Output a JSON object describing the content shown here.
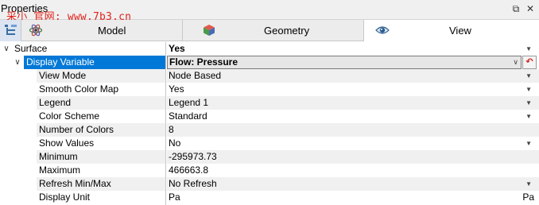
{
  "window": {
    "title": "Properties",
    "watermark": "采小 官网: www.7b3.cn"
  },
  "tabs": [
    {
      "label": "Model",
      "icon": "model-atom-icon"
    },
    {
      "label": "Geometry",
      "icon": "geometry-cube-icon"
    },
    {
      "label": "View",
      "icon": "eye-icon"
    }
  ],
  "grid": {
    "surface": {
      "label": "Surface",
      "value": "Yes"
    },
    "display_variable": {
      "label": "Display Variable",
      "value": "Flow: Pressure"
    },
    "rows": [
      {
        "label": "View Mode",
        "value": "Node Based",
        "dropdown": true
      },
      {
        "label": "Smooth Color Map",
        "value": "Yes",
        "dropdown": true
      },
      {
        "label": "Legend",
        "value": "Legend 1",
        "dropdown": true
      },
      {
        "label": "Color Scheme",
        "value": "Standard",
        "dropdown": true
      },
      {
        "label": "Number of Colors",
        "value": "8",
        "dropdown": false
      },
      {
        "label": "Show Values",
        "value": "No",
        "dropdown": true
      },
      {
        "label": "Minimum",
        "value": "-295973.73",
        "dropdown": false
      },
      {
        "label": "Maximum",
        "value": "466663.8",
        "dropdown": false
      },
      {
        "label": "Refresh Min/Max",
        "value": "No Refresh",
        "dropdown": true
      },
      {
        "label": "Display Unit",
        "value": "Pa",
        "unit": "Pa",
        "dropdown": false
      }
    ]
  },
  "colors": {
    "selection": "#0078d7",
    "alt_row": "#f0f0f0",
    "watermark": "#e0231c"
  }
}
